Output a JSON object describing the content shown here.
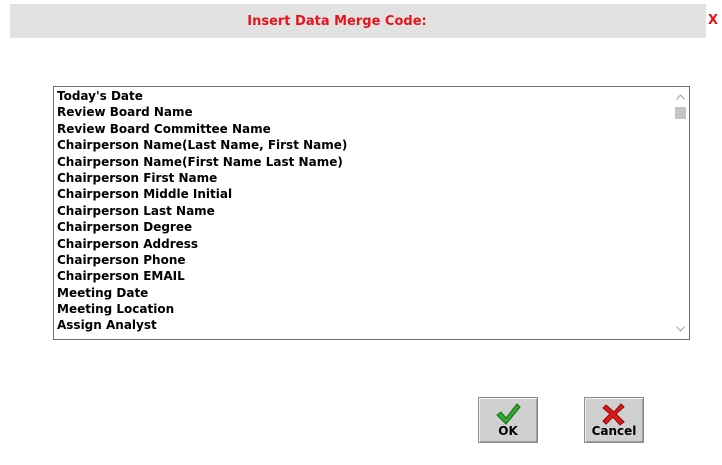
{
  "dialog": {
    "title": "Insert Data Merge Code:",
    "close_label": "X"
  },
  "merge_codes": {
    "items": [
      "Today's Date",
      "Review Board Name",
      "Review Board Committee Name",
      "Chairperson Name(Last Name, First Name)",
      "Chairperson Name(First Name Last Name)",
      "Chairperson First Name",
      "Chairperson Middle Initial",
      "Chairperson Last Name",
      "Chairperson Degree",
      "Chairperson Address",
      "Chairperson Phone",
      "Chairperson EMAIL",
      "Meeting Date",
      "Meeting Location",
      "Assign Analyst"
    ]
  },
  "buttons": {
    "ok_label": "OK",
    "cancel_label": "Cancel",
    "ok_icon": "green-check-icon",
    "cancel_icon": "red-x-icon"
  },
  "colors": {
    "title_text": "#e8141b",
    "title_bar": "#e2e2e2",
    "button_face": "#d0d0d0"
  }
}
